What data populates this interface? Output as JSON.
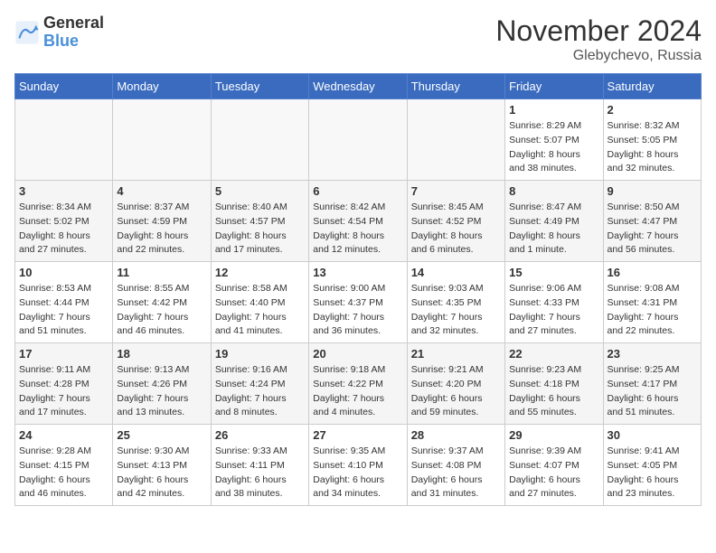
{
  "logo": {
    "line1": "General",
    "line2": "Blue"
  },
  "title": "November 2024",
  "subtitle": "Glebychevo, Russia",
  "days_of_week": [
    "Sunday",
    "Monday",
    "Tuesday",
    "Wednesday",
    "Thursday",
    "Friday",
    "Saturday"
  ],
  "weeks": [
    [
      {
        "day": "",
        "info": ""
      },
      {
        "day": "",
        "info": ""
      },
      {
        "day": "",
        "info": ""
      },
      {
        "day": "",
        "info": ""
      },
      {
        "day": "",
        "info": ""
      },
      {
        "day": "1",
        "info": "Sunrise: 8:29 AM\nSunset: 5:07 PM\nDaylight: 8 hours\nand 38 minutes."
      },
      {
        "day": "2",
        "info": "Sunrise: 8:32 AM\nSunset: 5:05 PM\nDaylight: 8 hours\nand 32 minutes."
      }
    ],
    [
      {
        "day": "3",
        "info": "Sunrise: 8:34 AM\nSunset: 5:02 PM\nDaylight: 8 hours\nand 27 minutes."
      },
      {
        "day": "4",
        "info": "Sunrise: 8:37 AM\nSunset: 4:59 PM\nDaylight: 8 hours\nand 22 minutes."
      },
      {
        "day": "5",
        "info": "Sunrise: 8:40 AM\nSunset: 4:57 PM\nDaylight: 8 hours\nand 17 minutes."
      },
      {
        "day": "6",
        "info": "Sunrise: 8:42 AM\nSunset: 4:54 PM\nDaylight: 8 hours\nand 12 minutes."
      },
      {
        "day": "7",
        "info": "Sunrise: 8:45 AM\nSunset: 4:52 PM\nDaylight: 8 hours\nand 6 minutes."
      },
      {
        "day": "8",
        "info": "Sunrise: 8:47 AM\nSunset: 4:49 PM\nDaylight: 8 hours\nand 1 minute."
      },
      {
        "day": "9",
        "info": "Sunrise: 8:50 AM\nSunset: 4:47 PM\nDaylight: 7 hours\nand 56 minutes."
      }
    ],
    [
      {
        "day": "10",
        "info": "Sunrise: 8:53 AM\nSunset: 4:44 PM\nDaylight: 7 hours\nand 51 minutes."
      },
      {
        "day": "11",
        "info": "Sunrise: 8:55 AM\nSunset: 4:42 PM\nDaylight: 7 hours\nand 46 minutes."
      },
      {
        "day": "12",
        "info": "Sunrise: 8:58 AM\nSunset: 4:40 PM\nDaylight: 7 hours\nand 41 minutes."
      },
      {
        "day": "13",
        "info": "Sunrise: 9:00 AM\nSunset: 4:37 PM\nDaylight: 7 hours\nand 36 minutes."
      },
      {
        "day": "14",
        "info": "Sunrise: 9:03 AM\nSunset: 4:35 PM\nDaylight: 7 hours\nand 32 minutes."
      },
      {
        "day": "15",
        "info": "Sunrise: 9:06 AM\nSunset: 4:33 PM\nDaylight: 7 hours\nand 27 minutes."
      },
      {
        "day": "16",
        "info": "Sunrise: 9:08 AM\nSunset: 4:31 PM\nDaylight: 7 hours\nand 22 minutes."
      }
    ],
    [
      {
        "day": "17",
        "info": "Sunrise: 9:11 AM\nSunset: 4:28 PM\nDaylight: 7 hours\nand 17 minutes."
      },
      {
        "day": "18",
        "info": "Sunrise: 9:13 AM\nSunset: 4:26 PM\nDaylight: 7 hours\nand 13 minutes."
      },
      {
        "day": "19",
        "info": "Sunrise: 9:16 AM\nSunset: 4:24 PM\nDaylight: 7 hours\nand 8 minutes."
      },
      {
        "day": "20",
        "info": "Sunrise: 9:18 AM\nSunset: 4:22 PM\nDaylight: 7 hours\nand 4 minutes."
      },
      {
        "day": "21",
        "info": "Sunrise: 9:21 AM\nSunset: 4:20 PM\nDaylight: 6 hours\nand 59 minutes."
      },
      {
        "day": "22",
        "info": "Sunrise: 9:23 AM\nSunset: 4:18 PM\nDaylight: 6 hours\nand 55 minutes."
      },
      {
        "day": "23",
        "info": "Sunrise: 9:25 AM\nSunset: 4:17 PM\nDaylight: 6 hours\nand 51 minutes."
      }
    ],
    [
      {
        "day": "24",
        "info": "Sunrise: 9:28 AM\nSunset: 4:15 PM\nDaylight: 6 hours\nand 46 minutes."
      },
      {
        "day": "25",
        "info": "Sunrise: 9:30 AM\nSunset: 4:13 PM\nDaylight: 6 hours\nand 42 minutes."
      },
      {
        "day": "26",
        "info": "Sunrise: 9:33 AM\nSunset: 4:11 PM\nDaylight: 6 hours\nand 38 minutes."
      },
      {
        "day": "27",
        "info": "Sunrise: 9:35 AM\nSunset: 4:10 PM\nDaylight: 6 hours\nand 34 minutes."
      },
      {
        "day": "28",
        "info": "Sunrise: 9:37 AM\nSunset: 4:08 PM\nDaylight: 6 hours\nand 31 minutes."
      },
      {
        "day": "29",
        "info": "Sunrise: 9:39 AM\nSunset: 4:07 PM\nDaylight: 6 hours\nand 27 minutes."
      },
      {
        "day": "30",
        "info": "Sunrise: 9:41 AM\nSunset: 4:05 PM\nDaylight: 6 hours\nand 23 minutes."
      }
    ]
  ]
}
